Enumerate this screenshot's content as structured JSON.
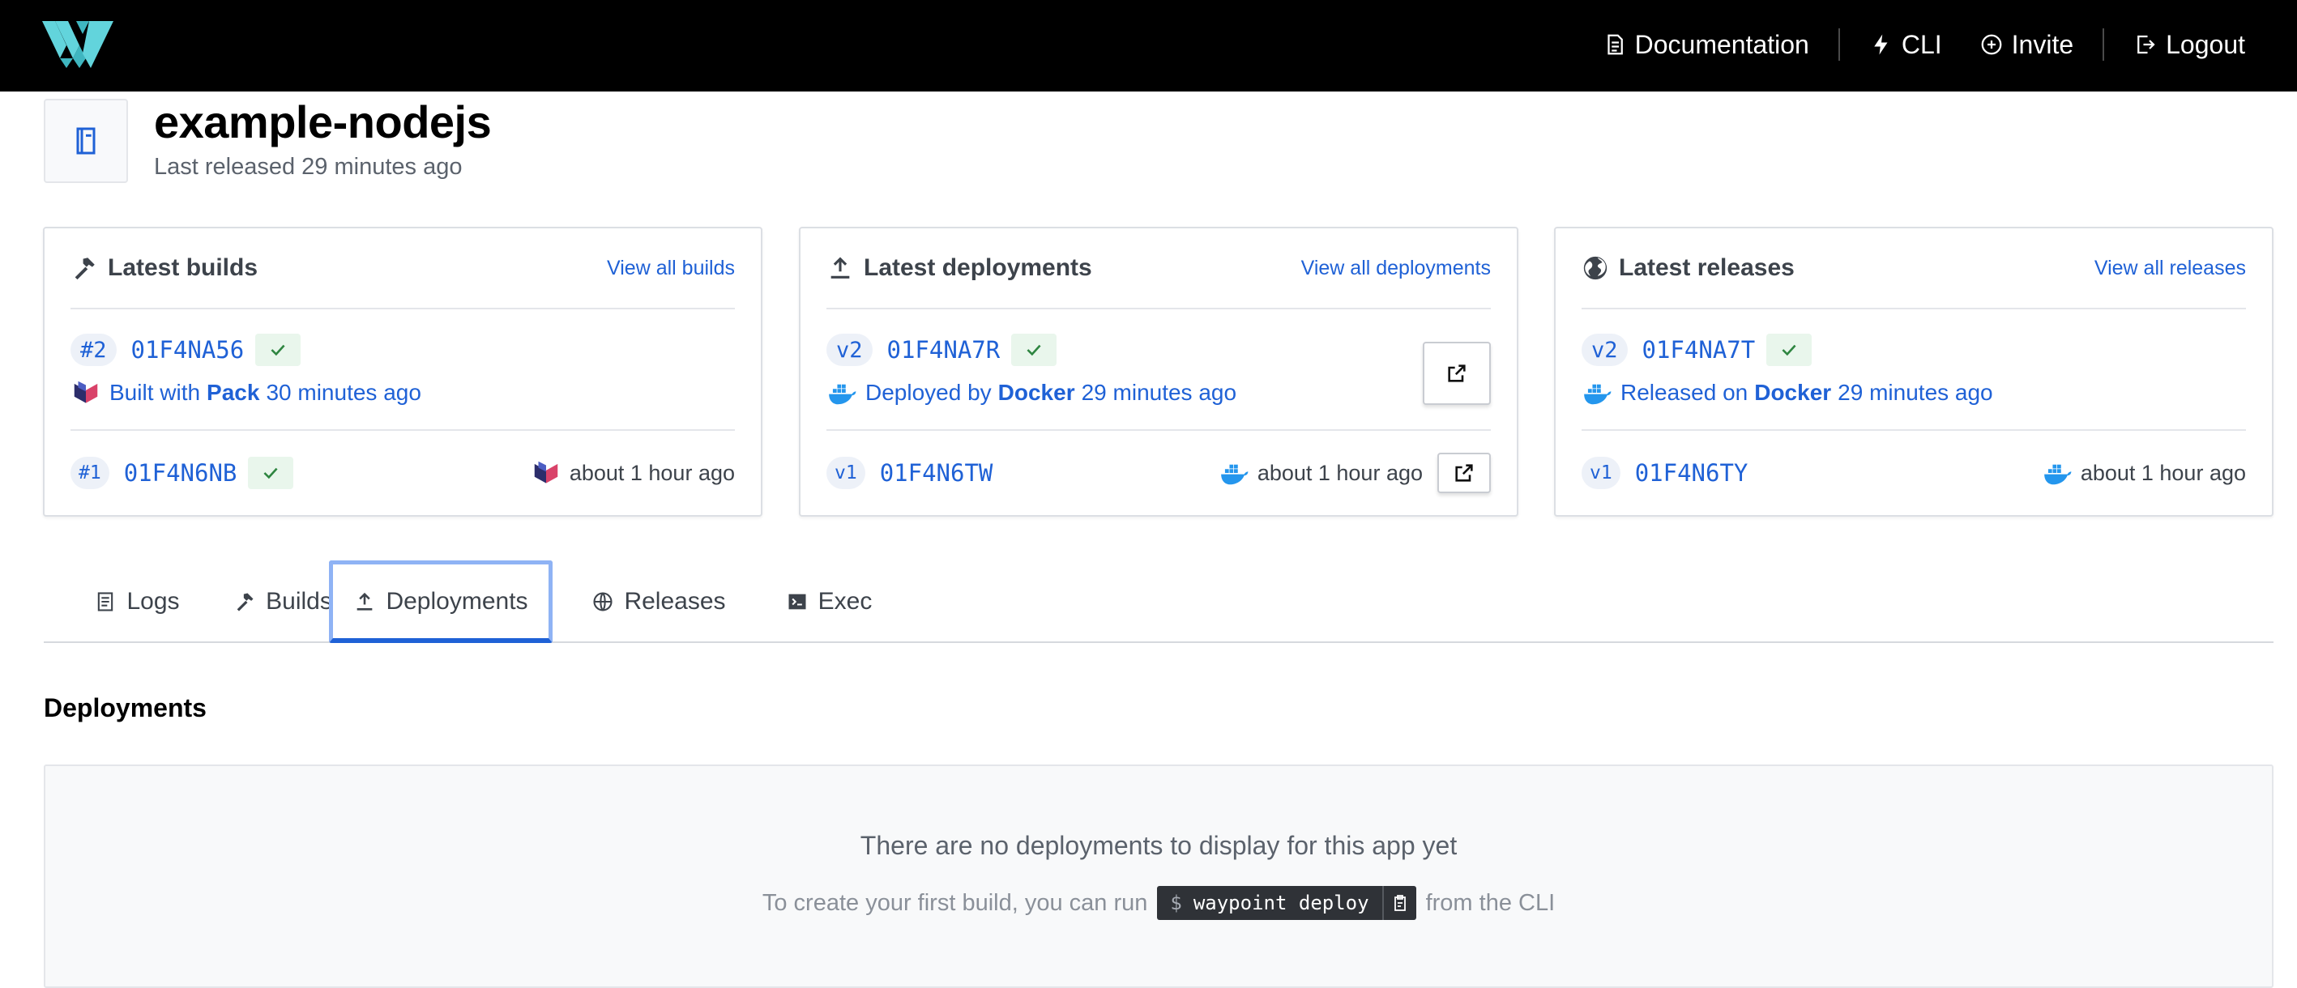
{
  "nav": {
    "logo": "waypoint-logo",
    "documentation": "Documentation",
    "cli": "CLI",
    "invite": "Invite",
    "logout": "Logout"
  },
  "app": {
    "name": "example-nodejs",
    "subtitle": "Last released 29 minutes ago"
  },
  "cards": {
    "builds": {
      "title": "Latest builds",
      "view_all": "View all builds",
      "latest": {
        "tag": "#2",
        "seq": "01F4NA56",
        "prefix": "Built with",
        "source": "Pack",
        "time": "30 minutes ago"
      },
      "previous": {
        "tag": "#1",
        "seq": "01F4N6NB",
        "time": "about 1 hour ago"
      }
    },
    "deployments": {
      "title": "Latest deployments",
      "view_all": "View all deployments",
      "latest": {
        "tag": "v2",
        "seq": "01F4NA7R",
        "prefix": "Deployed by",
        "source": "Docker",
        "time": "29 minutes ago"
      },
      "previous": {
        "tag": "v1",
        "seq": "01F4N6TW",
        "time": "about 1 hour ago"
      }
    },
    "releases": {
      "title": "Latest releases",
      "view_all": "View all releases",
      "latest": {
        "tag": "v2",
        "seq": "01F4NA7T",
        "prefix": "Released on",
        "source": "Docker",
        "time": "29 minutes ago"
      },
      "previous": {
        "tag": "v1",
        "seq": "01F4N6TY",
        "time": "about 1 hour ago"
      }
    }
  },
  "tabs": {
    "logs": "Logs",
    "builds": "Builds",
    "deployments": "Deployments",
    "releases": "Releases",
    "exec": "Exec",
    "active": "deployments"
  },
  "section": {
    "title": "Deployments",
    "empty_title": "There are no deployments to display for this app yet",
    "empty_prefix": "To create your first build, you can run",
    "command_prompt": "$",
    "command": "waypoint deploy",
    "empty_suffix": "from the CLI"
  },
  "colors": {
    "accent": "#1f61d6",
    "topbar": "#000000",
    "success": "#2e8540",
    "docker": "#2496ed"
  }
}
